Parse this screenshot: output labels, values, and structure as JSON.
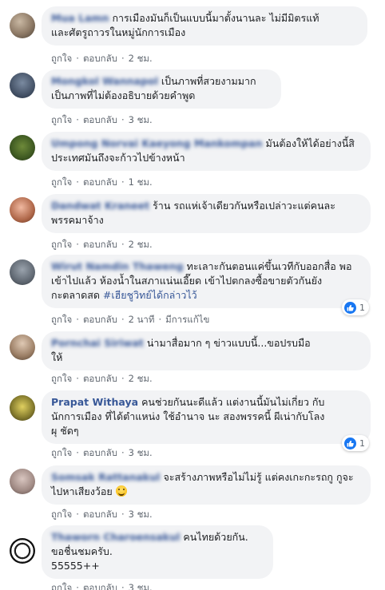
{
  "comments": [
    {
      "author": "Mua Lamn",
      "lines": [
        "การเมืองมันก็เป็นแบบนี้มาตั้งนานละ ไม่มีมิตรแท้",
        "และศัตรูถาวรในหมู่นักการเมือง"
      ],
      "like": "ถูกใจ",
      "reply": "ตอบกลับ",
      "time": "2 ชม."
    },
    {
      "author": "Mongkol Wannapol",
      "lines": [
        "เป็นภาพที่สวยงามมาก",
        "เป็นภาพที่ไม่ต้องอธิบายด้วยคำพูด"
      ],
      "like": "ถูกใจ",
      "reply": "ตอบกลับ",
      "time": "3 ชม."
    },
    {
      "author": "Umpong Norvai Kaeyong Mankompan",
      "lines": [
        "มันต้องให้ได้อย่างนี้สิ",
        "ประเทศมันถึงจะก้าวไปข้างหน้า"
      ],
      "like": "ถูกใจ",
      "reply": "ตอบกลับ",
      "time": "1 ชม."
    },
    {
      "author": "Dandwat Kraneet",
      "lines": [
        "ร้าน รถแห่เจ้าเดียวกันหรือเปล่าวะแต่คนละ",
        "พรรคมาจ้าง"
      ],
      "like": "ถูกใจ",
      "reply": "ตอบกลับ",
      "time": "2 ชม."
    },
    {
      "author": "Wirut Namdin Thaweng",
      "lines": [
        "ทะเลาะกันตอนแค่ขึ้นเวทีกับออกสื่อ พอ",
        "เข้าไปแล้ว ห้องน้ำในสภาแน่นเอี๊ยด เข้าไปตกลงซื้อขายตัวกันยัง",
        "กะตลาดสด "
      ],
      "hashtag": "#เฮียชูวิทย์ได้กล่าวไว้",
      "like": "ถูกใจ",
      "reply": "ตอบกลับ",
      "time": "2 นาที",
      "edited": "มีการแก้ไข",
      "reactions": "1"
    },
    {
      "author": "Pornchai Siriwat",
      "lines": [
        "น่ามาสื่อมาก ๆ ข่าวแบบนี้...ขอปรบมือ",
        "ให้"
      ],
      "like": "ถูกใจ",
      "reply": "ตอบกลับ",
      "time": "2 ชม."
    },
    {
      "author": "Prapat Withaya",
      "lines": [
        "คนช่วยกันนะดีแล้ว แต่งานนี้มันไม่เกี่ยว กับ",
        "นักการเมือง ที่ได้ตำแหน่ง ใช้อำนาจ นะ สองพรรคนี้ ผีเน่ากับโลง",
        "ผุ ชัดๆ"
      ],
      "like": "ถูกใจ",
      "reply": "ตอบกลับ",
      "time": "3 ชม.",
      "reactions": "1"
    },
    {
      "author": "Somsak Rattanakul",
      "lines": [
        "จะสร้างภาพหรือไม่ไม่รู้ แต่คงเกะกะรถกู กูจะ",
        "ไปหาเสียงว้อย"
      ],
      "like": "ถูกใจ",
      "reply": "ตอบกลับ",
      "time": "3 ชม."
    },
    {
      "author": "Thaworn Charoensakul",
      "lines": [
        "คนไทยด้วยกัน.",
        "ขอชื่นชมครับ.",
        "55555++"
      ],
      "like": "ถูกใจ",
      "reply": "ตอบกลับ",
      "time": "3 ชม."
    }
  ],
  "icons": {
    "like": "thumbs-up-icon",
    "emoji": "smiling-face-emoji-icon"
  },
  "colors": {
    "bubble": "#f2f3f5",
    "author": "#385898",
    "meta": "#606770",
    "like_blue": "#1877f2"
  }
}
